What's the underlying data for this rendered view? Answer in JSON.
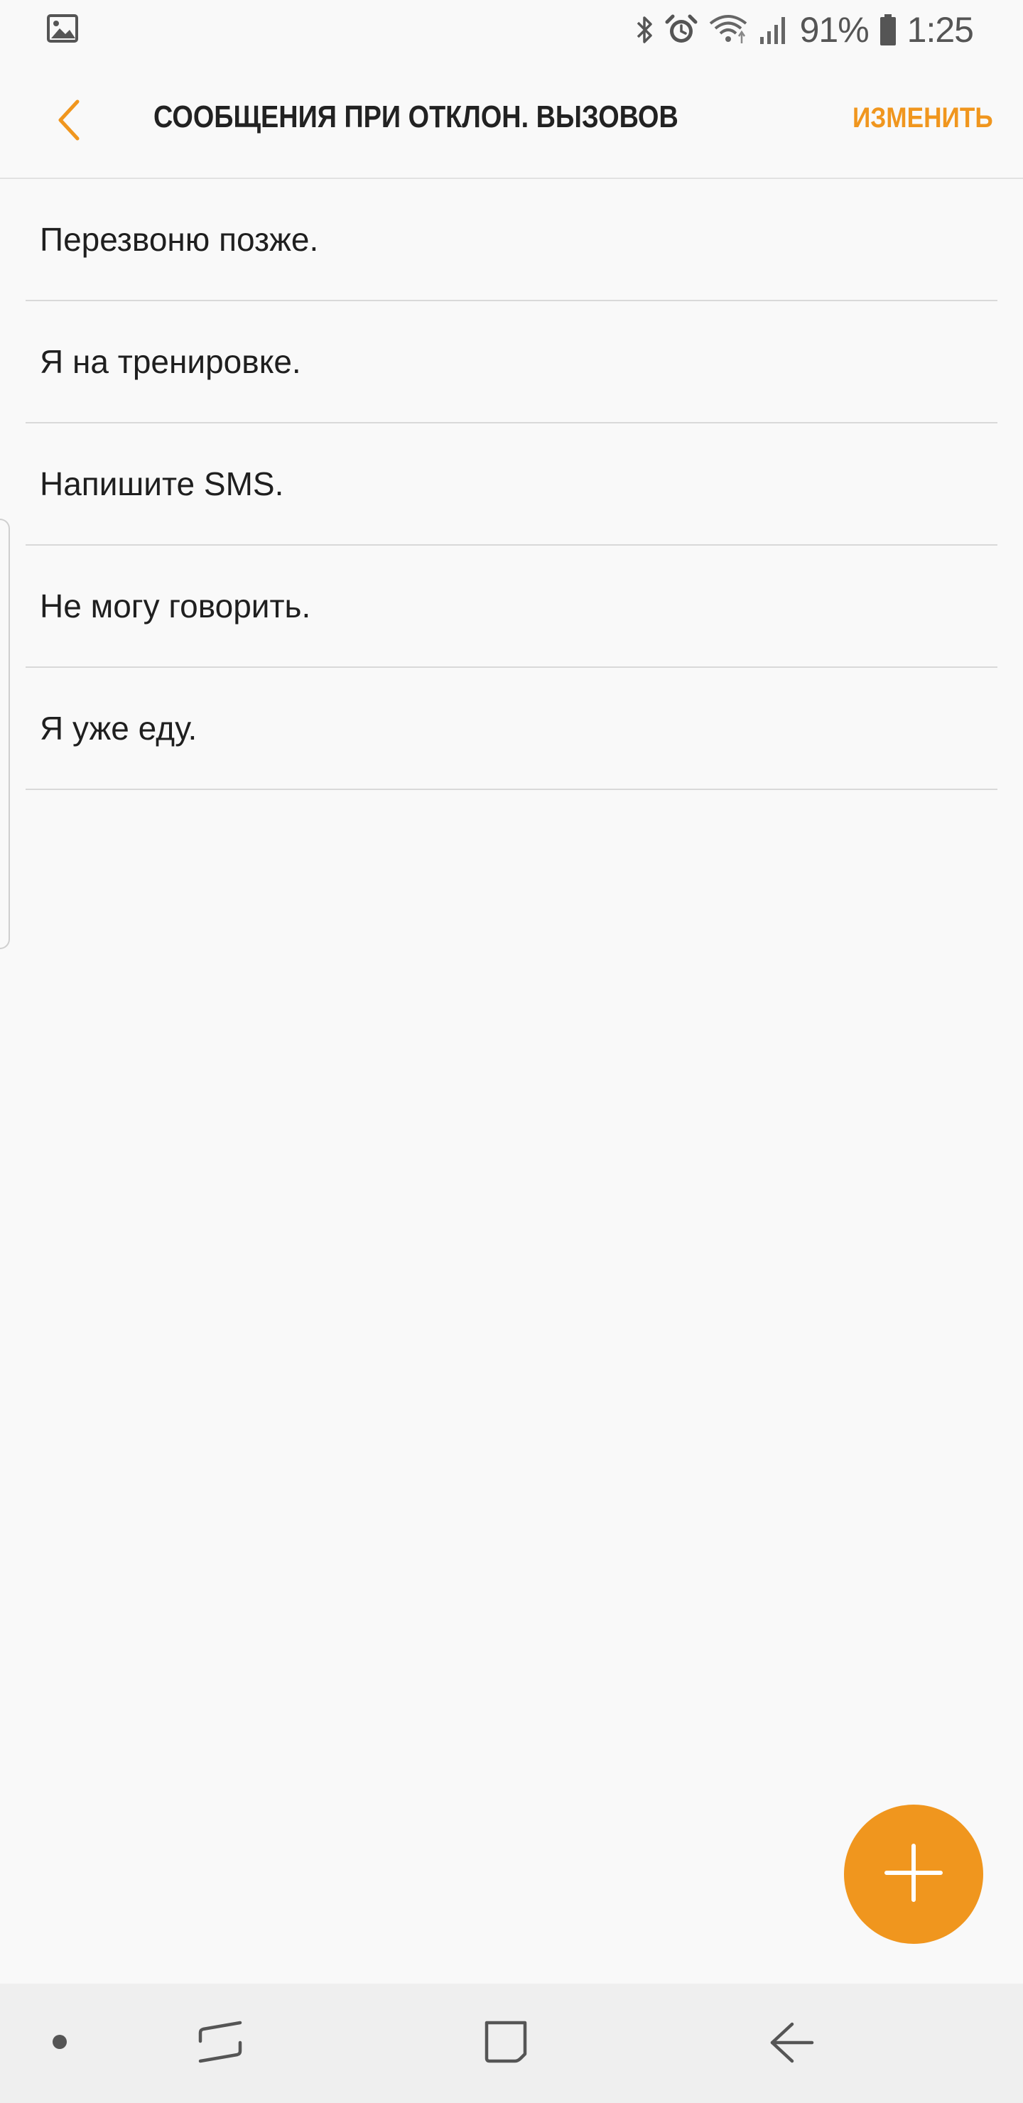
{
  "status_bar": {
    "battery_percent": "91%",
    "time": "1:25",
    "icons": [
      "gallery-notification-icon",
      "bluetooth-icon",
      "alarm-icon",
      "wifi-icon",
      "signal-icon",
      "battery-icon"
    ]
  },
  "header": {
    "title": "СООБЩЕНИЯ ПРИ ОТКЛОН. ВЫЗОВОВ",
    "edit_label": "ИЗМЕНИТЬ",
    "back_icon": "chevron-left-icon"
  },
  "messages": [
    {
      "text": "Перезвоню позже."
    },
    {
      "text": "Я на тренировке."
    },
    {
      "text": "Напишите SMS."
    },
    {
      "text": "Не могу говорить."
    },
    {
      "text": "Я уже еду."
    }
  ],
  "fab": {
    "icon": "plus-icon"
  },
  "nav_bar": {
    "icons": [
      "dot-icon",
      "recent-apps-icon",
      "home-icon",
      "back-arrow-icon"
    ]
  },
  "colors": {
    "accent": "#f0961e",
    "background": "#f9f9f9",
    "nav_background": "#efefef",
    "divider": "#d9d9d9"
  }
}
